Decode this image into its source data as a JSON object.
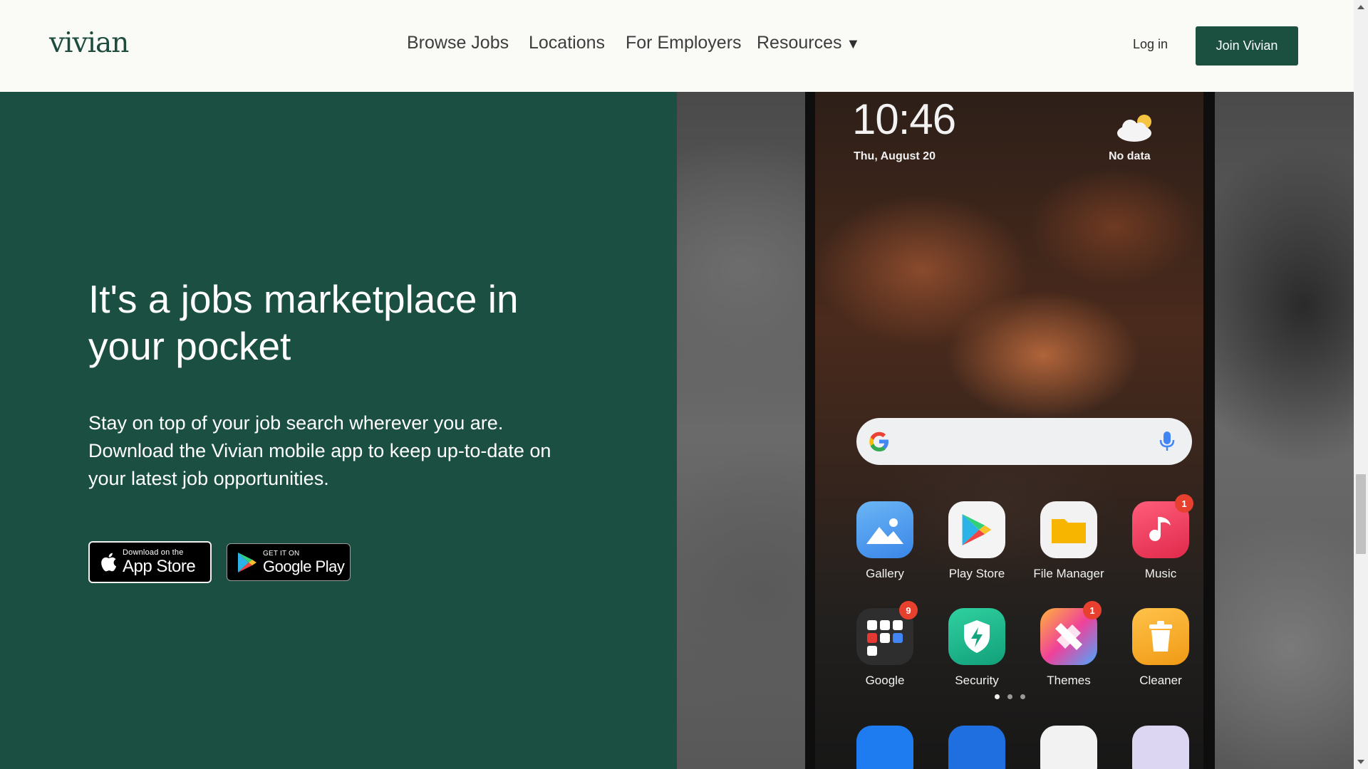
{
  "header": {
    "logo": "vivian",
    "nav": {
      "browse_jobs": "Browse Jobs",
      "locations": "Locations",
      "for_employers": "For Employers",
      "resources": "Resources",
      "resources_caret": "▼"
    },
    "login": "Log in",
    "join": "Join Vivian"
  },
  "hero": {
    "title": "It's a jobs marketplace in your pocket",
    "description": "Stay on top of your job search wherever you are. Download the Vivian mobile app to keep up-to-date on your latest job opportunities.",
    "app_store": {
      "small": "Download on the",
      "big": "App Store"
    },
    "google_play": {
      "small": "GET IT ON",
      "big": "Google Play"
    }
  },
  "phone": {
    "time": "10:46",
    "date": "Thu, August 20",
    "weather": "No data",
    "apps_row1": [
      {
        "label": "Gallery",
        "icon": "gallery-icon",
        "color": "#4a9af0"
      },
      {
        "label": "Play Store",
        "icon": "play-store-icon",
        "color": "#f4f4f4"
      },
      {
        "label": "File Manager",
        "icon": "folder-icon",
        "color": "#f2f2f2"
      },
      {
        "label": "Music",
        "icon": "music-icon",
        "color": "#ee3c5c",
        "badge": "1"
      }
    ],
    "apps_row2": [
      {
        "label": "Google",
        "icon": "google-folder-icon",
        "color": "#2e2e2e",
        "badge": "9"
      },
      {
        "label": "Security",
        "icon": "security-icon",
        "color": "#19b38a"
      },
      {
        "label": "Themes",
        "icon": "themes-icon",
        "color": "#e15ab0",
        "badge": "1"
      },
      {
        "label": "Cleaner",
        "icon": "cleaner-icon",
        "color": "#f5a623"
      }
    ]
  },
  "colors": {
    "hero_green": "#1a4f42",
    "button_green": "#1b5040",
    "logo_green": "#1d4b3d"
  }
}
